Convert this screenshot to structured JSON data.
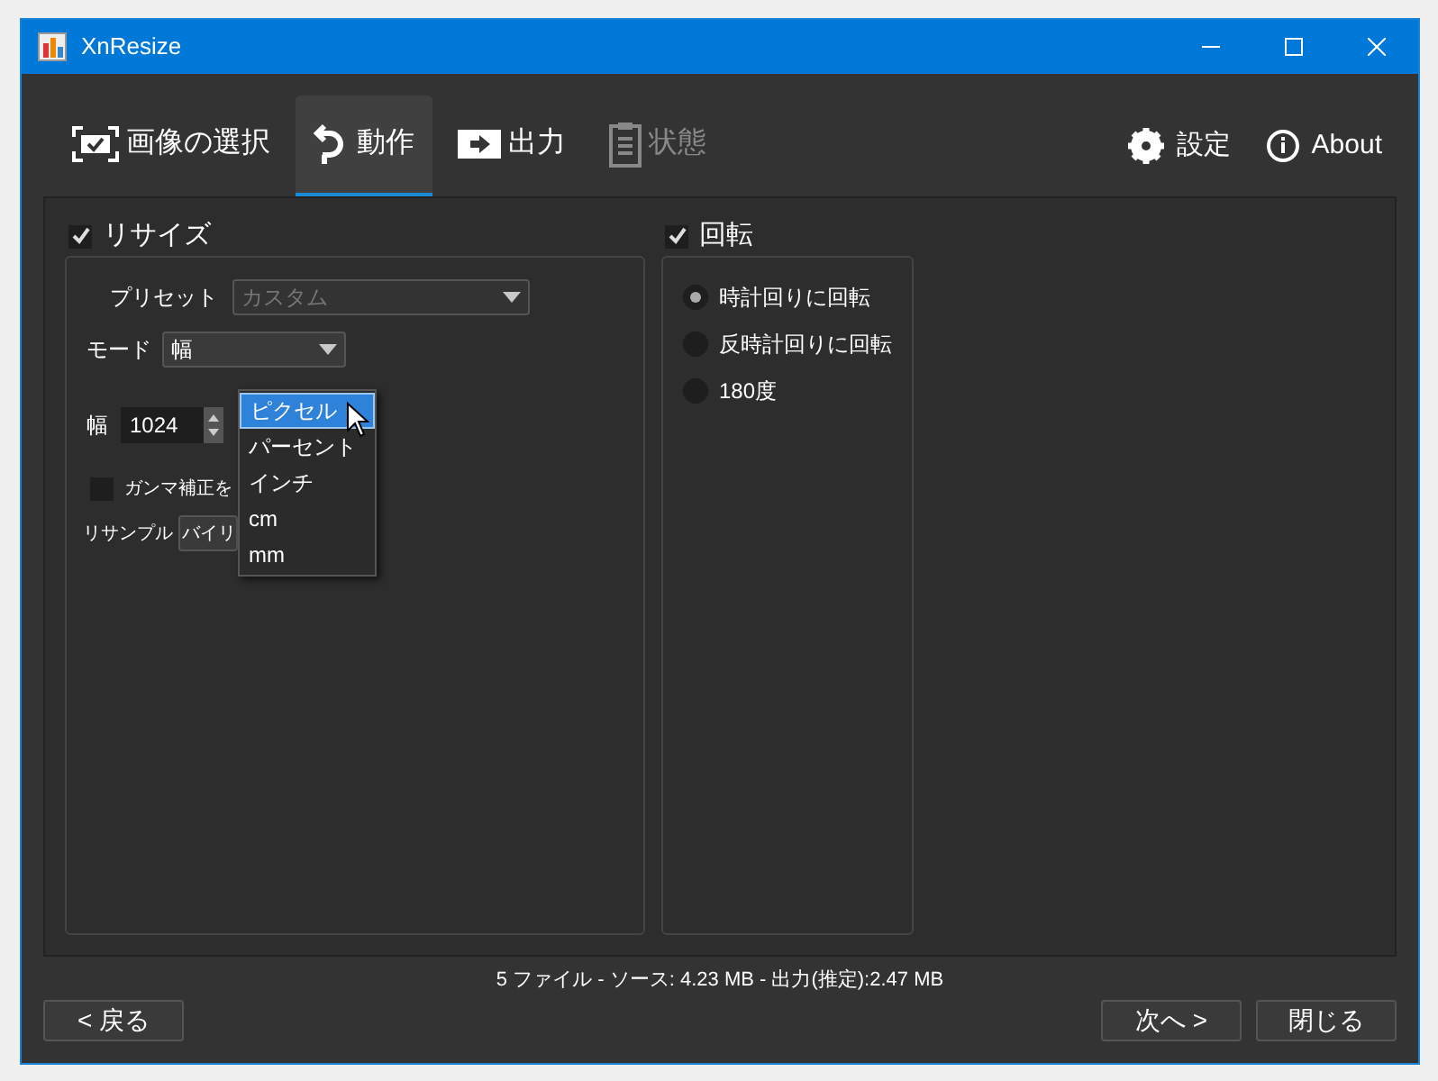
{
  "window": {
    "title": "XnResize"
  },
  "tabs": [
    {
      "label": "画像の選択",
      "selected": false,
      "disabled": false
    },
    {
      "label": "動作",
      "selected": true,
      "disabled": false
    },
    {
      "label": "出力",
      "selected": false,
      "disabled": false
    },
    {
      "label": "状態",
      "selected": false,
      "disabled": true
    }
  ],
  "toolbar_right": [
    {
      "label": "設定"
    },
    {
      "label": "About"
    }
  ],
  "resize": {
    "label": "リサイズ",
    "checked": true,
    "preset": {
      "label": "プリセット",
      "value": "カスタム",
      "disabled": true
    },
    "mode": {
      "label": "モード",
      "value": "幅"
    },
    "width": {
      "label": "幅",
      "value": "1024"
    },
    "unit_menu": [
      {
        "label": "ピクセル",
        "selected": true
      },
      {
        "label": "パーセント",
        "selected": false
      },
      {
        "label": "インチ",
        "selected": false
      },
      {
        "label": "cm",
        "selected": false
      },
      {
        "label": "mm",
        "selected": false
      }
    ],
    "gamma": {
      "label": "ガンマ補正を",
      "checked": false
    },
    "resample": {
      "label": "リサンプル",
      "value": "バイリ"
    }
  },
  "rotate": {
    "label": "回転",
    "checked": true,
    "options": [
      {
        "label": "時計回りに回転",
        "selected": true
      },
      {
        "label": "反時計回りに回転",
        "selected": false
      },
      {
        "label": "180度",
        "selected": false
      }
    ]
  },
  "status": "5 ファイル - ソース: 4.23 MB - 出力(推定):2.47 MB",
  "buttons": [
    {
      "label": "< 戻る"
    },
    {
      "label": "次へ >"
    },
    {
      "label": "閉じる"
    }
  ]
}
